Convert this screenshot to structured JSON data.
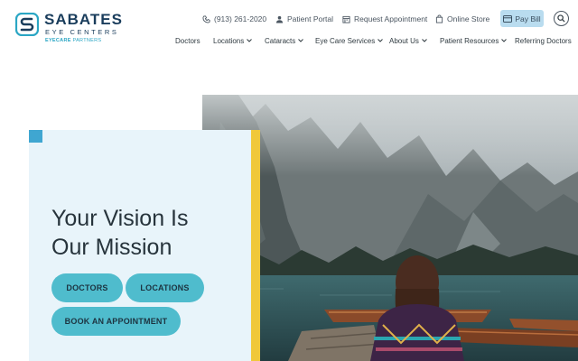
{
  "logo": {
    "title": "SABATES",
    "subtitle": "EYE CENTERS",
    "partner_brand": "EYECARE",
    "partner_suffix": " PARTNERS"
  },
  "utility": {
    "phone": "(913) 261-2020",
    "portal": "Patient Portal",
    "appointment": "Request Appointment",
    "store": "Online Store",
    "pay_bill": "Pay Bill"
  },
  "nav": {
    "items": [
      {
        "label": "Doctors",
        "dropdown": false
      },
      {
        "label": "Locations",
        "dropdown": true
      },
      {
        "label": "Cataracts",
        "dropdown": true
      },
      {
        "label": "Eye Care Services",
        "dropdown": true
      },
      {
        "label": "About Us",
        "dropdown": true
      },
      {
        "label": "Patient Resources",
        "dropdown": true
      },
      {
        "label": "Referring Doctors",
        "dropdown": false
      }
    ]
  },
  "hero": {
    "headline_line1": "Your Vision Is",
    "headline_line2": "Our Mission",
    "buttons": {
      "doctors": "DOCTORS",
      "locations": "LOCATIONS",
      "book": "BOOK AN APPOINTMENT"
    }
  },
  "colors": {
    "brand_navy": "#1a3d5c",
    "brand_teal": "#2aa6c4",
    "button_teal": "#4fbccd",
    "card_bg": "#e8f4fa",
    "accent_yellow": "#f0c83a",
    "accent_blue": "#3fa6d1",
    "pay_bill_bg": "#b9dcef"
  },
  "icons": {
    "phone": "phone-icon",
    "portal": "user-icon",
    "appointment": "calendar-icon",
    "store": "shopping-bag-icon",
    "pay_bill": "credit-card-icon",
    "search": "search-icon"
  }
}
